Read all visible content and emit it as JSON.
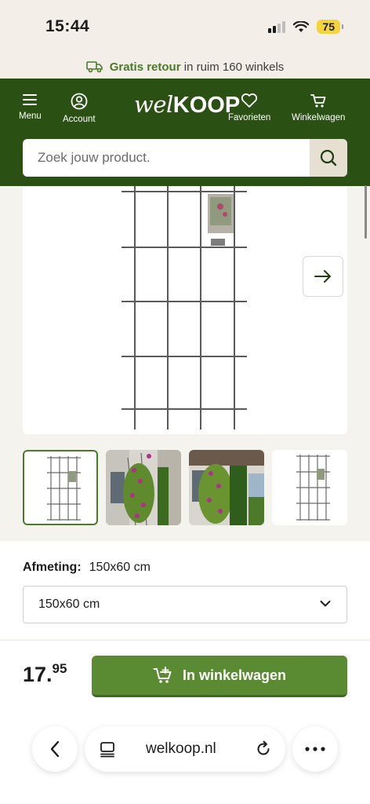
{
  "status_bar": {
    "time": "15:44",
    "battery": "75"
  },
  "promo": {
    "bold_text": "Gratis retour",
    "text": "in ruim 160 winkels"
  },
  "header": {
    "nav_left": [
      {
        "label": "Menu",
        "icon": "menu-icon"
      },
      {
        "label": "Account",
        "icon": "account-icon"
      }
    ],
    "logo": {
      "prefix": "wel",
      "suffix": "KOOP"
    },
    "nav_right": [
      {
        "label": "Favorieten",
        "icon": "heart-icon"
      },
      {
        "label": "Winkelwagen",
        "icon": "cart-icon"
      }
    ],
    "search_placeholder": "Zoek jouw product."
  },
  "product": {
    "gallery_thumbnail_count": 4,
    "active_thumbnail": 1,
    "size_label": "Afmeting:",
    "size_value": "150x60 cm",
    "size_selected": "150x60 cm",
    "price_main": "17.",
    "price_cents": "95",
    "cart_button": "In winkelwagen"
  },
  "browser": {
    "url": "welkoop.nl"
  },
  "colors": {
    "header_green": "#2b5014",
    "accent_green": "#5a8a32",
    "promo_green": "#4b7a2b"
  }
}
